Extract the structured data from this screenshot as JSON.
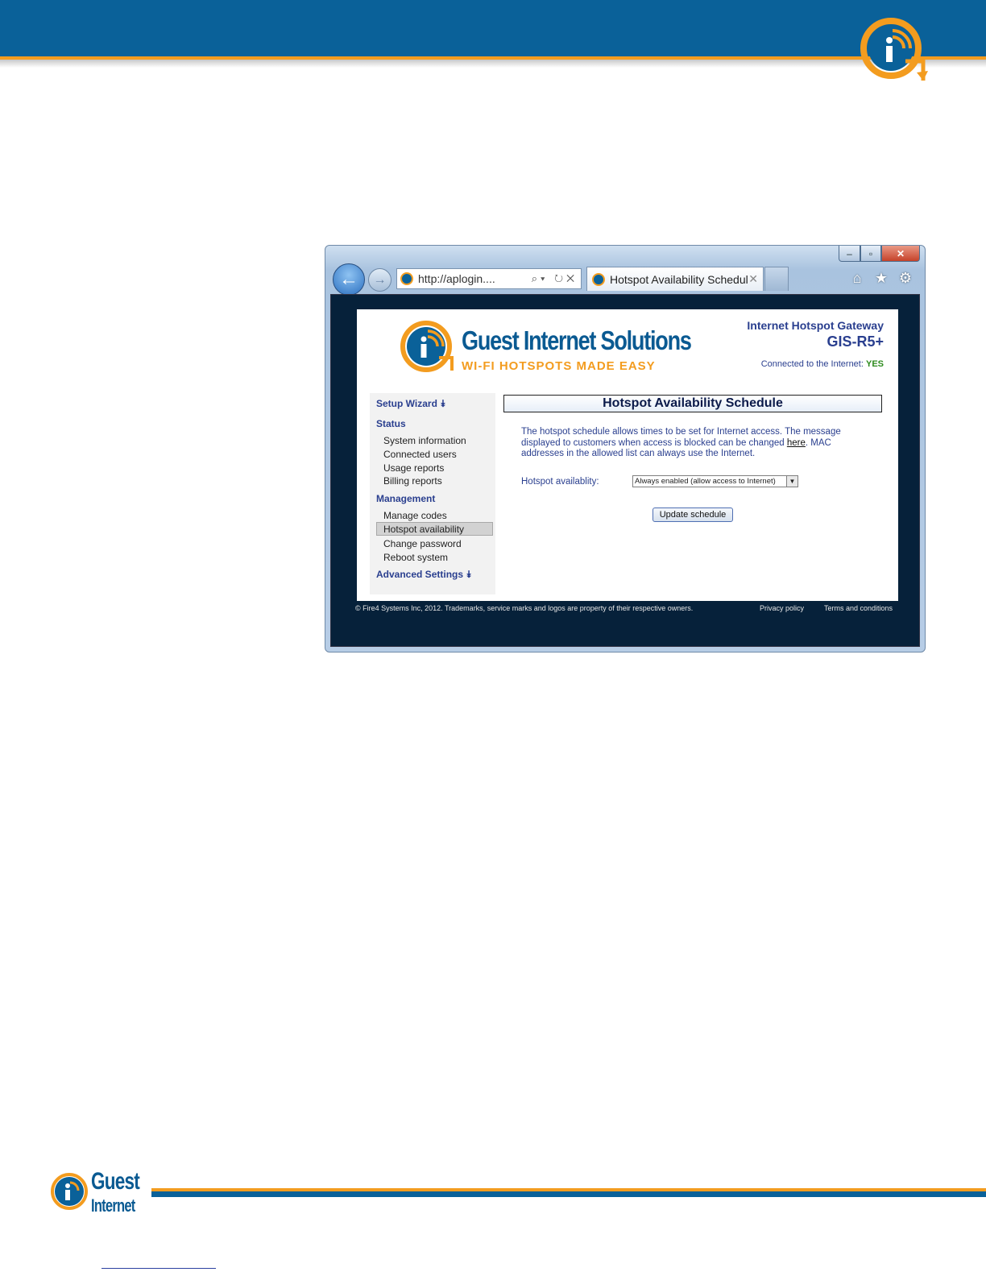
{
  "colors": {
    "brand_blue": "#0a6199",
    "brand_orange": "#f39c1f",
    "nav_text": "#2a3f8f",
    "status_green": "#2e8b1e"
  },
  "browser": {
    "address": "http://aplogin....",
    "tab_title": "Hotspot Availability Schedule",
    "window_controls": {
      "minimize": "‒",
      "maximize": "▫",
      "close": "✕"
    },
    "toolbar_icons": [
      "home-icon",
      "star-icon",
      "gear-icon"
    ]
  },
  "site": {
    "name": "Guest Internet Solutions",
    "tagline": "WI-FI HOTSPOTS MADE EASY",
    "product_line1": "Internet Hotspot Gateway",
    "product_line2": "GIS-R5+",
    "connected_label": "Connected to the Internet:",
    "connected_value": "YES"
  },
  "sidebar": {
    "setup_wizard": "Setup Wizard ⯯",
    "status_heading": "Status",
    "status_items": [
      "System information",
      "Connected users",
      "Usage reports",
      "Billing reports"
    ],
    "management_heading": "Management",
    "management_items": [
      "Manage codes",
      "Hotspot availability",
      "Change password",
      "Reboot system"
    ],
    "advanced": "Advanced Settings ⯯"
  },
  "main": {
    "title": "Hotspot Availability Schedule",
    "desc_part1": "The hotspot schedule allows times to be set for Internet access. The message displayed to customers when access is blocked can be changed ",
    "desc_link": "here",
    "desc_part2": ". MAC addresses in the allowed list can always use the Internet.",
    "availability_label": "Hotspot availablity:",
    "availability_value": "Always enabled (allow access to Internet)",
    "update_button": "Update schedule"
  },
  "footer": {
    "copyright": "© Fire4 Systems Inc, 2012. Trademarks, service marks and logos are property of their respective owners.",
    "privacy": "Privacy policy",
    "terms": "Terms and conditions"
  },
  "doc": {
    "bottom_logo_word1": "Guest",
    "bottom_logo_word2": "Internet"
  }
}
